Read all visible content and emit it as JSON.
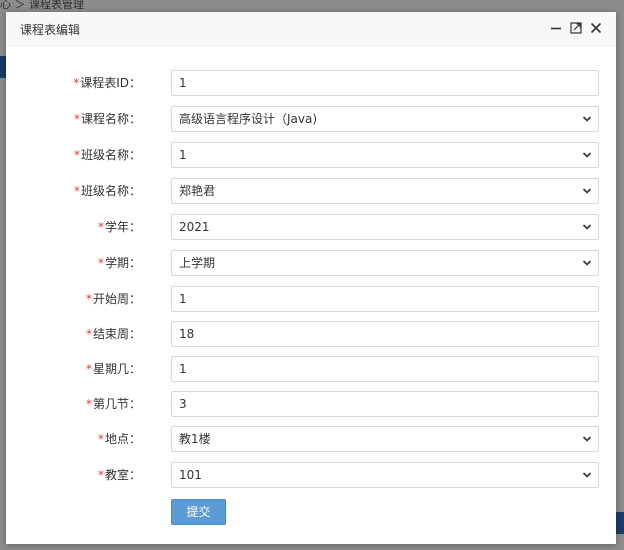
{
  "background": {
    "breadcrumb": "心 ＞ 课程表管理"
  },
  "dialog": {
    "title": "课程表编辑",
    "controls": {
      "minimize_icon": "minimize-icon",
      "maximize_icon": "maximize-icon",
      "close_icon": "close-icon"
    }
  },
  "form": {
    "required_mark": "*",
    "fields": [
      {
        "label": "课程表ID：",
        "type": "text",
        "value": "1"
      },
      {
        "label": "课程名称：",
        "type": "select",
        "value": "高级语言程序设计（Java)"
      },
      {
        "label": "班级名称：",
        "type": "select",
        "value": "1"
      },
      {
        "label": "班级名称：",
        "type": "select",
        "value": "郑艳君"
      },
      {
        "label": "学年：",
        "type": "select",
        "value": "2021"
      },
      {
        "label": "学期：",
        "type": "select",
        "value": "上学期"
      },
      {
        "label": "开始周：",
        "type": "text",
        "value": "1"
      },
      {
        "label": "结束周：",
        "type": "text",
        "value": "18"
      },
      {
        "label": "星期几：",
        "type": "text",
        "value": "1"
      },
      {
        "label": "第几节：",
        "type": "text",
        "value": "3"
      },
      {
        "label": "地点：",
        "type": "select",
        "value": "教1楼"
      },
      {
        "label": "教室：",
        "type": "select",
        "value": "101"
      }
    ],
    "submit_label": "提交"
  },
  "colors": {
    "required": "#e4393c",
    "submit_button": "#5b9bd5",
    "header_bg": "#f8f8f8"
  }
}
